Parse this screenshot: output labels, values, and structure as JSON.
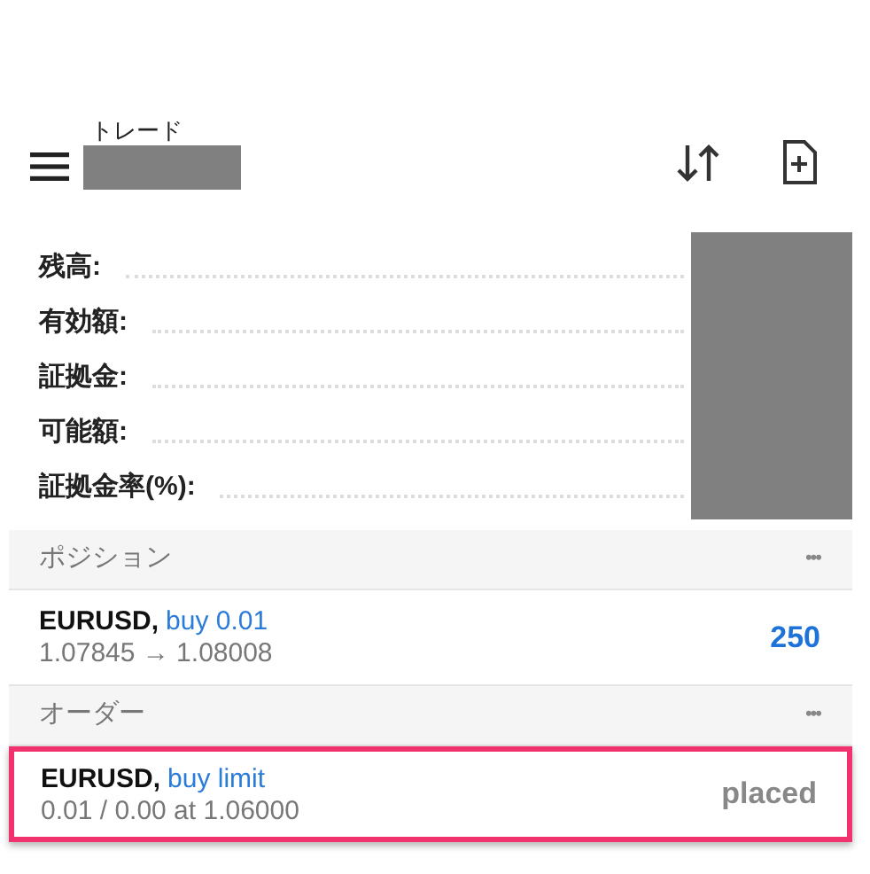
{
  "header": {
    "title": "トレード"
  },
  "account": [
    {
      "label": "残高:"
    },
    {
      "label": "有効額:"
    },
    {
      "label": "証拠金:"
    },
    {
      "label": "可能額:"
    },
    {
      "label": "証拠金率(%):"
    }
  ],
  "sections": [
    {
      "title": "ポジション",
      "menu": "•••",
      "items": [
        {
          "symbol": "EURUSD,",
          "action": "buy 0.01",
          "detail": "1.07845 → 1.08008",
          "result": "250",
          "kind": "profit",
          "highlighted": false
        }
      ]
    },
    {
      "title": "オーダー",
      "menu": "•••",
      "items": [
        {
          "symbol": "EURUSD,",
          "action": "buy limit",
          "detail": "0.01 / 0.00 at 1.06000",
          "result": "placed",
          "kind": "status",
          "highlighted": true
        }
      ]
    }
  ]
}
